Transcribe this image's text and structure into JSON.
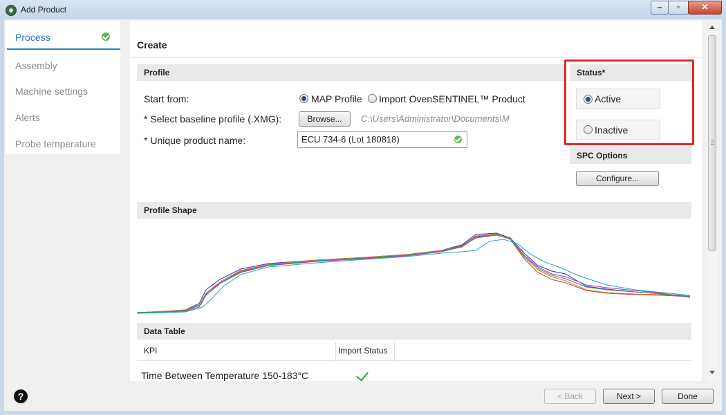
{
  "window": {
    "title": "Add Product"
  },
  "sidebar": {
    "items": [
      {
        "label": "Process",
        "active": true,
        "completed": true
      },
      {
        "label": "Assembly"
      },
      {
        "label": "Machine settings"
      },
      {
        "label": "Alerts"
      },
      {
        "label": "Probe temperature"
      }
    ]
  },
  "main": {
    "title": "Create",
    "profile": {
      "header": "Profile",
      "start_from_label": "Start from:",
      "option_map": "MAP Profile",
      "option_import": "Import OvenSENTINEL™ Product",
      "selected": "MAP Profile",
      "baseline_label": "*  Select baseline profile (.XMG):",
      "browse_label": "Browse...",
      "baseline_path": "C:\\Users\\Administrator\\Documents\\M",
      "product_name_label": "*  Unique product name:",
      "product_name_value": "ECU 734-6 (Lot 180818)"
    },
    "status": {
      "header": "Status*",
      "active_label": "Active",
      "inactive_label": "Inactive",
      "selected": "Active"
    },
    "spc": {
      "header": "SPC Options",
      "configure_label": "Configure..."
    },
    "profile_shape": {
      "header": "Profile Shape",
      "series_colors": [
        "#2b2bd6",
        "#d43a3a",
        "#b03bb0",
        "#2aa0c8",
        "#e07a2a",
        "#2a9a6a"
      ]
    },
    "data_table": {
      "header": "Data Table",
      "columns": [
        "KPI",
        "Import Status"
      ],
      "rows": [
        {
          "kpi": "Time Between Temperature 150-183°C",
          "status": "ok"
        }
      ]
    }
  },
  "footer": {
    "help_label": "?",
    "back_label": "< Back",
    "next_label": "Next >",
    "done_label": "Done"
  }
}
